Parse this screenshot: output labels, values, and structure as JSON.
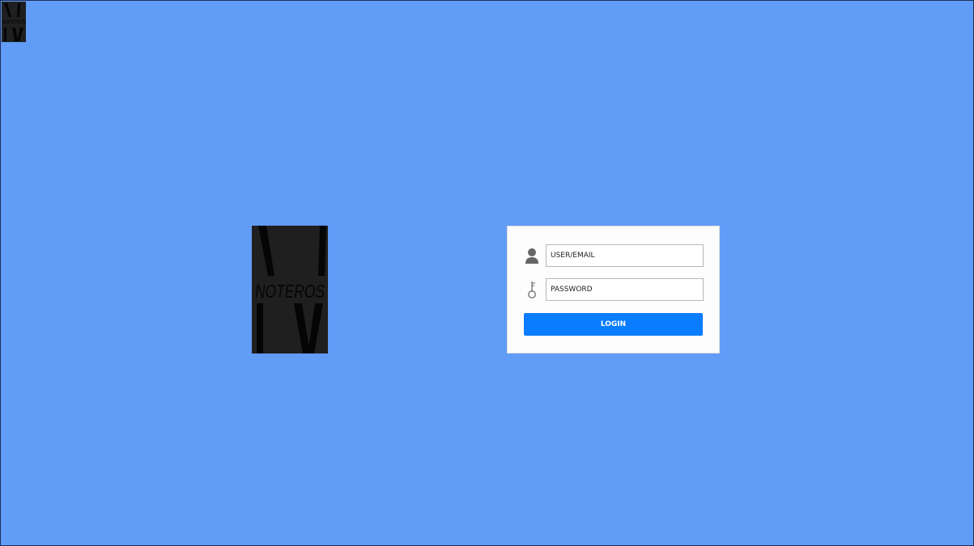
{
  "app": {
    "background_color": "#619cf7",
    "logo_text": "NOTEROS",
    "logo_background": "#1f1f1f"
  },
  "login": {
    "user_placeholder": "USER/EMAIL",
    "user_value": "",
    "user_icon": "user-icon",
    "password_placeholder": "PASSWORD",
    "password_value": "",
    "password_icon": "key-icon",
    "login_label": "LOGIN",
    "button_color": "#0a7cff"
  }
}
